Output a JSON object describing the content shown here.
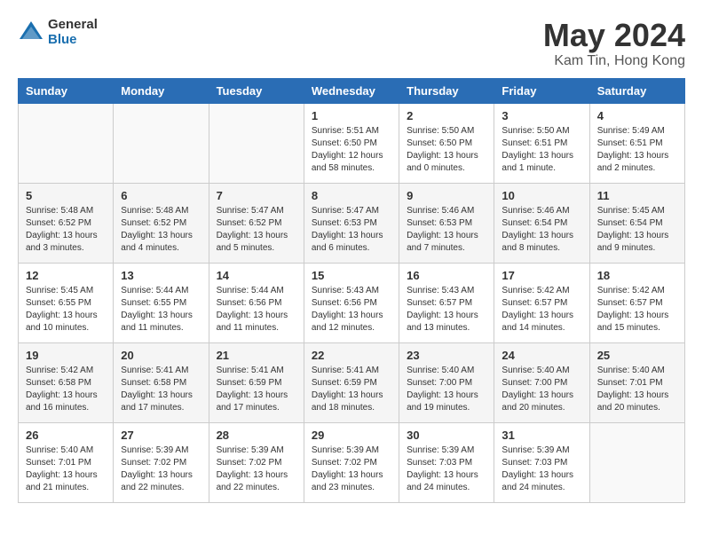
{
  "header": {
    "logo_general": "General",
    "logo_blue": "Blue",
    "title": "May 2024",
    "location": "Kam Tin, Hong Kong"
  },
  "weekdays": [
    "Sunday",
    "Monday",
    "Tuesday",
    "Wednesday",
    "Thursday",
    "Friday",
    "Saturday"
  ],
  "weeks": [
    [
      {
        "day": "",
        "info": ""
      },
      {
        "day": "",
        "info": ""
      },
      {
        "day": "",
        "info": ""
      },
      {
        "day": "1",
        "info": "Sunrise: 5:51 AM\nSunset: 6:50 PM\nDaylight: 12 hours\nand 58 minutes."
      },
      {
        "day": "2",
        "info": "Sunrise: 5:50 AM\nSunset: 6:50 PM\nDaylight: 13 hours\nand 0 minutes."
      },
      {
        "day": "3",
        "info": "Sunrise: 5:50 AM\nSunset: 6:51 PM\nDaylight: 13 hours\nand 1 minute."
      },
      {
        "day": "4",
        "info": "Sunrise: 5:49 AM\nSunset: 6:51 PM\nDaylight: 13 hours\nand 2 minutes."
      }
    ],
    [
      {
        "day": "5",
        "info": "Sunrise: 5:48 AM\nSunset: 6:52 PM\nDaylight: 13 hours\nand 3 minutes."
      },
      {
        "day": "6",
        "info": "Sunrise: 5:48 AM\nSunset: 6:52 PM\nDaylight: 13 hours\nand 4 minutes."
      },
      {
        "day": "7",
        "info": "Sunrise: 5:47 AM\nSunset: 6:52 PM\nDaylight: 13 hours\nand 5 minutes."
      },
      {
        "day": "8",
        "info": "Sunrise: 5:47 AM\nSunset: 6:53 PM\nDaylight: 13 hours\nand 6 minutes."
      },
      {
        "day": "9",
        "info": "Sunrise: 5:46 AM\nSunset: 6:53 PM\nDaylight: 13 hours\nand 7 minutes."
      },
      {
        "day": "10",
        "info": "Sunrise: 5:46 AM\nSunset: 6:54 PM\nDaylight: 13 hours\nand 8 minutes."
      },
      {
        "day": "11",
        "info": "Sunrise: 5:45 AM\nSunset: 6:54 PM\nDaylight: 13 hours\nand 9 minutes."
      }
    ],
    [
      {
        "day": "12",
        "info": "Sunrise: 5:45 AM\nSunset: 6:55 PM\nDaylight: 13 hours\nand 10 minutes."
      },
      {
        "day": "13",
        "info": "Sunrise: 5:44 AM\nSunset: 6:55 PM\nDaylight: 13 hours\nand 11 minutes."
      },
      {
        "day": "14",
        "info": "Sunrise: 5:44 AM\nSunset: 6:56 PM\nDaylight: 13 hours\nand 11 minutes."
      },
      {
        "day": "15",
        "info": "Sunrise: 5:43 AM\nSunset: 6:56 PM\nDaylight: 13 hours\nand 12 minutes."
      },
      {
        "day": "16",
        "info": "Sunrise: 5:43 AM\nSunset: 6:57 PM\nDaylight: 13 hours\nand 13 minutes."
      },
      {
        "day": "17",
        "info": "Sunrise: 5:42 AM\nSunset: 6:57 PM\nDaylight: 13 hours\nand 14 minutes."
      },
      {
        "day": "18",
        "info": "Sunrise: 5:42 AM\nSunset: 6:57 PM\nDaylight: 13 hours\nand 15 minutes."
      }
    ],
    [
      {
        "day": "19",
        "info": "Sunrise: 5:42 AM\nSunset: 6:58 PM\nDaylight: 13 hours\nand 16 minutes."
      },
      {
        "day": "20",
        "info": "Sunrise: 5:41 AM\nSunset: 6:58 PM\nDaylight: 13 hours\nand 17 minutes."
      },
      {
        "day": "21",
        "info": "Sunrise: 5:41 AM\nSunset: 6:59 PM\nDaylight: 13 hours\nand 17 minutes."
      },
      {
        "day": "22",
        "info": "Sunrise: 5:41 AM\nSunset: 6:59 PM\nDaylight: 13 hours\nand 18 minutes."
      },
      {
        "day": "23",
        "info": "Sunrise: 5:40 AM\nSunset: 7:00 PM\nDaylight: 13 hours\nand 19 minutes."
      },
      {
        "day": "24",
        "info": "Sunrise: 5:40 AM\nSunset: 7:00 PM\nDaylight: 13 hours\nand 20 minutes."
      },
      {
        "day": "25",
        "info": "Sunrise: 5:40 AM\nSunset: 7:01 PM\nDaylight: 13 hours\nand 20 minutes."
      }
    ],
    [
      {
        "day": "26",
        "info": "Sunrise: 5:40 AM\nSunset: 7:01 PM\nDaylight: 13 hours\nand 21 minutes."
      },
      {
        "day": "27",
        "info": "Sunrise: 5:39 AM\nSunset: 7:02 PM\nDaylight: 13 hours\nand 22 minutes."
      },
      {
        "day": "28",
        "info": "Sunrise: 5:39 AM\nSunset: 7:02 PM\nDaylight: 13 hours\nand 22 minutes."
      },
      {
        "day": "29",
        "info": "Sunrise: 5:39 AM\nSunset: 7:02 PM\nDaylight: 13 hours\nand 23 minutes."
      },
      {
        "day": "30",
        "info": "Sunrise: 5:39 AM\nSunset: 7:03 PM\nDaylight: 13 hours\nand 24 minutes."
      },
      {
        "day": "31",
        "info": "Sunrise: 5:39 AM\nSunset: 7:03 PM\nDaylight: 13 hours\nand 24 minutes."
      },
      {
        "day": "",
        "info": ""
      }
    ]
  ]
}
